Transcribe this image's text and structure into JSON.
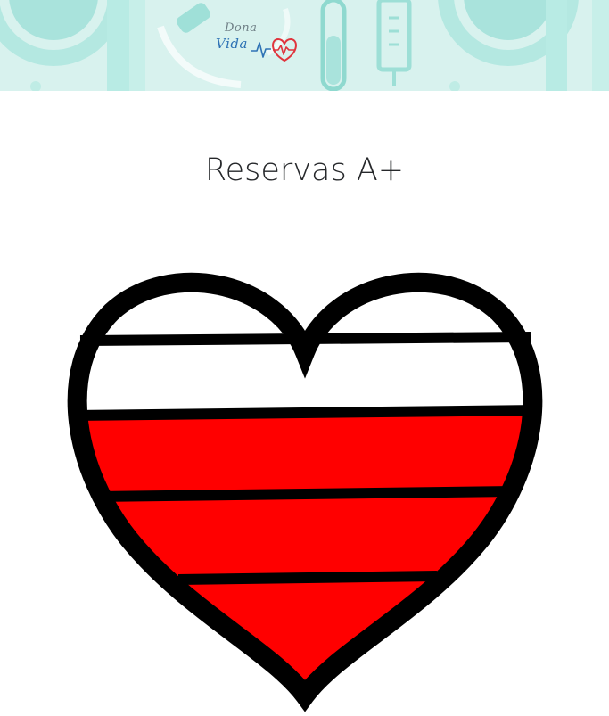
{
  "banner": {
    "background_color": "#d8f2ee",
    "accent_color": "#a9e3dc",
    "logo": {
      "top_text": "Dona",
      "bottom_text": "Vida",
      "icon": "heartbeat-heart-icon",
      "text_color": "#2f73b5",
      "heart_color": "#e0343d"
    }
  },
  "page": {
    "title": "Reservas A+"
  },
  "reserve": {
    "blood_type": "A+",
    "levels_total": 4,
    "levels_filled": 3,
    "fill_color": "#ff0000",
    "empty_color": "#ffffff",
    "outline_color": "#000000"
  }
}
